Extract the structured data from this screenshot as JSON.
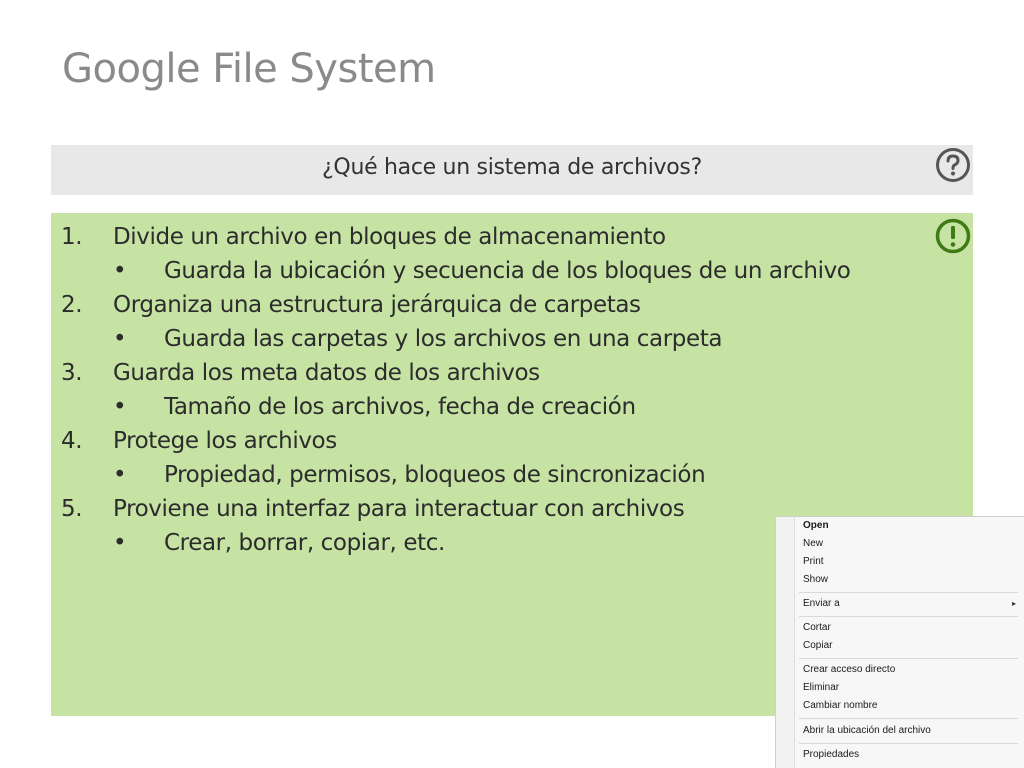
{
  "slide": {
    "title": "Google File System"
  },
  "question_bar": {
    "text": "¿Qué hace un sistema de archivos?",
    "icon": "question-circle-icon"
  },
  "content": {
    "icon": "exclamation-circle-icon",
    "accent_color": "#3f7a14",
    "background_color": "#c6e3a4",
    "items": [
      {
        "number": "1.",
        "text": "Divide un archivo en bloques de almacenamiento",
        "sub": "Guarda la ubicación y secuencia de los bloques de un archivo"
      },
      {
        "number": "2.",
        "text": "Organiza una estructura jerárquica de carpetas",
        "sub": "Guarda las carpetas y los archivos en una carpeta"
      },
      {
        "number": "3.",
        "text": "Guarda los meta datos de los archivos",
        "sub": "Tamaño de los archivos, fecha de creación"
      },
      {
        "number": "4.",
        "text": "Protege los archivos",
        "sub": "Propiedad, permisos, bloqueos de sincronización"
      },
      {
        "number": "5.",
        "text": "Proviene una interfaz para interactuar con archivos",
        "sub": "Crear, borrar, copiar, etc."
      }
    ],
    "bullet": "•"
  },
  "context_menu": {
    "groups": [
      [
        "Open",
        "New",
        "Print",
        "Show"
      ],
      [
        "Enviar a"
      ],
      [
        "Cortar",
        "Copiar"
      ],
      [
        "Crear acceso directo",
        "Eliminar",
        "Cambiar nombre"
      ],
      [
        "Abrir la ubicación del archivo"
      ],
      [
        "Propiedades"
      ]
    ],
    "submenu_arrow": "▸"
  }
}
